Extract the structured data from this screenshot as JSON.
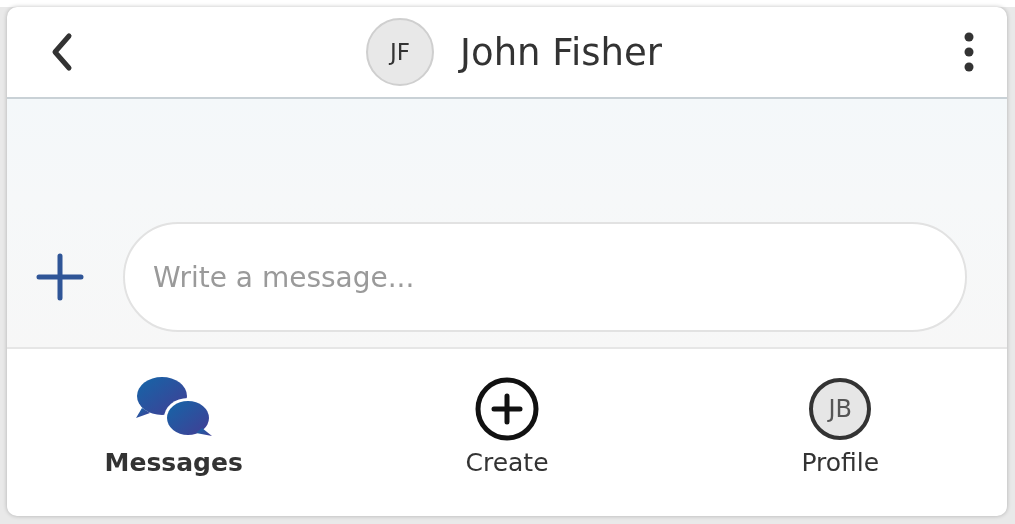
{
  "header": {
    "avatar_initials": "JF",
    "title": "John Fisher"
  },
  "composer": {
    "placeholder": "Write a message..."
  },
  "nav": [
    {
      "kind": "messages",
      "label": "Messages",
      "selected": true
    },
    {
      "kind": "create",
      "label": "Create",
      "selected": false
    },
    {
      "kind": "profile",
      "label": "Profile",
      "initials": "JB",
      "selected": false
    }
  ]
}
